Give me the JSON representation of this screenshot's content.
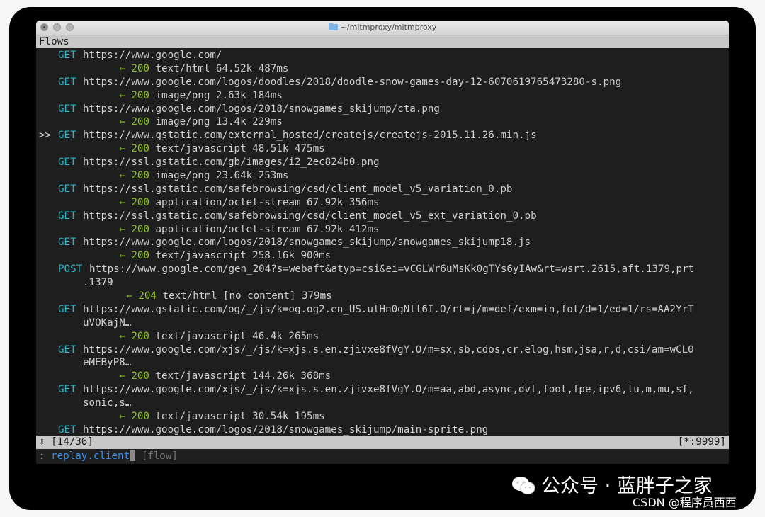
{
  "window": {
    "title": "~/mitmproxy/mitmproxy"
  },
  "header": {
    "label": "Flows"
  },
  "flows": [
    {
      "ptr": "",
      "method": "GET",
      "url": "https://www.google.com/",
      "url2": "",
      "arrow": "←",
      "code": "200",
      "info": "text/html 64.52k 487ms"
    },
    {
      "ptr": "",
      "method": "GET",
      "url": "https://www.google.com/logos/doodles/2018/doodle-snow-games-day-12-6070619765473280-s.png",
      "url2": "",
      "arrow": "←",
      "code": "200",
      "info": "image/png 2.63k 184ms"
    },
    {
      "ptr": "",
      "method": "GET",
      "url": "https://www.google.com/logos/2018/snowgames_skijump/cta.png",
      "url2": "",
      "arrow": "←",
      "code": "200",
      "info": "image/png 13.4k 229ms"
    },
    {
      "ptr": ">>",
      "method": "GET",
      "url": "https://www.gstatic.com/external_hosted/createjs/createjs-2015.11.26.min.js",
      "url2": "",
      "arrow": "←",
      "code": "200",
      "info": "text/javascript 48.51k 475ms"
    },
    {
      "ptr": "",
      "method": "GET",
      "url": "https://ssl.gstatic.com/gb/images/i2_2ec824b0.png",
      "url2": "",
      "arrow": "←",
      "code": "200",
      "info": "image/png 23.64k 253ms"
    },
    {
      "ptr": "",
      "method": "GET",
      "url": "https://ssl.gstatic.com/safebrowsing/csd/client_model_v5_variation_0.pb",
      "url2": "",
      "arrow": "←",
      "code": "200",
      "info": "application/octet-stream 67.92k 356ms"
    },
    {
      "ptr": "",
      "method": "GET",
      "url": "https://ssl.gstatic.com/safebrowsing/csd/client_model_v5_ext_variation_0.pb",
      "url2": "",
      "arrow": "←",
      "code": "200",
      "info": "application/octet-stream 67.92k 412ms"
    },
    {
      "ptr": "",
      "method": "GET",
      "url": "https://www.google.com/logos/2018/snowgames_skijump/snowgames_skijump18.js",
      "url2": "",
      "arrow": "←",
      "code": "200",
      "info": "text/javascript 258.16k 900ms"
    },
    {
      "ptr": "",
      "method": "POST",
      "url": "https://www.google.com/gen_204?s=webaft&atyp=csi&ei=vCGLWr6uMsKk0gTYs6yIAw&rt=wsrt.2615,aft.1379,prt",
      "url2": ".1379",
      "arrow": "←",
      "code": "204",
      "info": "text/html [no content] 379ms"
    },
    {
      "ptr": "",
      "method": "GET",
      "url": "https://www.gstatic.com/og/_/js/k=og.og2.en_US.ulHn0gNll6I.O/rt=j/m=def/exm=in,fot/d=1/ed=1/rs=AA2YrT",
      "url2": "uVOKajN…",
      "arrow": "←",
      "code": "200",
      "info": "text/javascript 46.4k 265ms"
    },
    {
      "ptr": "",
      "method": "GET",
      "url": "https://www.google.com/xjs/_/js/k=xjs.s.en.zjivxe8fVgY.O/m=sx,sb,cdos,cr,elog,hsm,jsa,r,d,csi/am=wCL0",
      "url2": "eMEByP8…",
      "arrow": "←",
      "code": "200",
      "info": "text/javascript 144.26k 368ms"
    },
    {
      "ptr": "",
      "method": "GET",
      "url": "https://www.google.com/xjs/_/js/k=xjs.s.en.zjivxe8fVgY.O/m=aa,abd,async,dvl,foot,fpe,ipv6,lu,m,mu,sf,",
      "url2": "sonic,s…",
      "arrow": "←",
      "code": "200",
      "info": "text/javascript 30.54k 195ms"
    },
    {
      "ptr": "",
      "method": "GET",
      "url": "https://www.google.com/logos/2018/snowgames_skijump/main-sprite.png",
      "url2": "",
      "arrow": "",
      "code": "",
      "info": ""
    }
  ],
  "status": {
    "arrow": "⇩",
    "position": "[14/36]",
    "listen": "[*:9999]"
  },
  "command": {
    "prompt": ":",
    "text": "replay.client",
    "hint": "[flow]"
  },
  "watermark": {
    "brand": "公众号 · 蓝胖子之家",
    "credit": "CSDN @程序员西西"
  },
  "colors": {
    "method": "#2bb4c6",
    "response": "#8fbf2a",
    "command": "#3a8eea",
    "bar": "#c8c8c8",
    "terminal_bg": "#1e1e1e"
  }
}
